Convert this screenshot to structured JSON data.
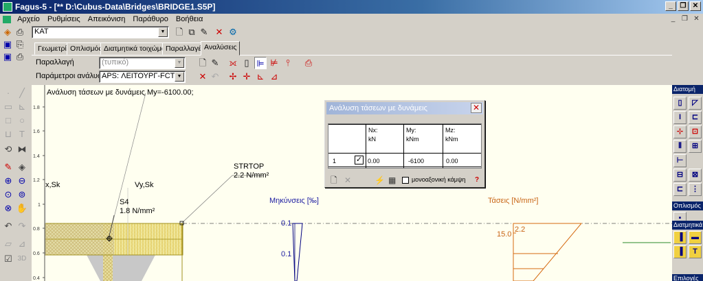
{
  "window": {
    "title": "Fagus-5 - [** D:\\Cubus-Data\\Bridges\\BRIDGE1.S5P]",
    "minimize": "_",
    "restore": "❐",
    "close": "✕"
  },
  "menu": [
    "Αρχείο",
    "Ρυθμίσεις",
    "Απεικόνιση",
    "Παράθυρο",
    "Βοήθεια"
  ],
  "mdi": {
    "minimize": "_",
    "restore": "❐",
    "close": "✕"
  },
  "toolbar": {
    "cross_section_value": "KAT"
  },
  "tabs": [
    "Γεωμετρία",
    "Οπλισμός",
    "Διατμητικά τοιχώματα",
    "Παραλλαγές",
    "Αναλύσεις"
  ],
  "active_tab": 4,
  "analysis": {
    "variant_label": "Παραλλαγή",
    "variant_value": "(τυπικό)",
    "params_label": "Παράμετροι ανάλυσης",
    "params_value": "APS: ΛΕΙΤΟΥΡΓ-FCT"
  },
  "canvas": {
    "heading": "Ανάλυση τάσεων με δυνάμεις My=-6100.00;",
    "axis_ticks": [
      "1.8",
      "1.6",
      "1.4",
      "1.2",
      "1",
      "0.8",
      "0.6",
      "0.4"
    ],
    "labels": {
      "x_sk": "x,Sk",
      "vy_sk": "Vy,Sk",
      "s4_name": "S4",
      "s4_value": "1.8 N/mm²",
      "strtop_name": "STRTOP",
      "strtop_value": "2.2 N/mm²",
      "strain_title": "Μηκύνσεις [‰]",
      "stress_title": "Τάσεις [N/mm²]",
      "strain_value_top": "0.1",
      "strain_value_low": "0.1",
      "stress_left": "15.0",
      "stress_right": "2.2"
    }
  },
  "right_panel": {
    "sections": [
      "Διατομή",
      "Οπλισμός",
      "Διατμητικά",
      "Επιλογές"
    ]
  },
  "dialog": {
    "title": "Ανάλυση τάσεων με δυνάμεις",
    "close": "✕",
    "columns": [
      {
        "name": "Nx:",
        "unit": "kN"
      },
      {
        "name": "My:",
        "unit": "kNm"
      },
      {
        "name": "Mz:",
        "unit": "kNm"
      }
    ],
    "rows": [
      {
        "index": "1",
        "checked": "✓",
        "nx": "0.00",
        "my": "-6100",
        "mz": "0.00"
      }
    ],
    "uniaxial_label": "μονοαξονική κάμψη",
    "help": "?"
  }
}
